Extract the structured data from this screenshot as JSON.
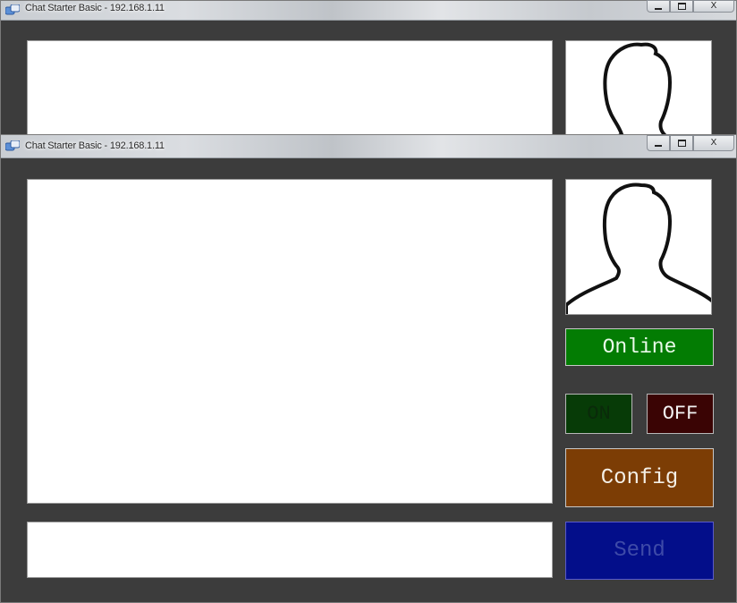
{
  "windows": {
    "back": {
      "title": "Chat Starter Basic - 192.168.1.11",
      "controls": {
        "minimize": "minimize",
        "maximize": "maximize",
        "close": "X"
      }
    },
    "front": {
      "title": "Chat Starter Basic - 192.168.1.11",
      "controls": {
        "minimize": "minimize",
        "maximize": "maximize",
        "close": "X"
      }
    }
  },
  "main": {
    "chat_log": "",
    "message_input": {
      "value": "",
      "placeholder": ""
    },
    "avatar": "user-silhouette-icon",
    "status_label": "Online",
    "on_label": "ON",
    "off_label": "OFF",
    "config_label": "Config",
    "send_label": "Send"
  },
  "colors": {
    "background": "#3c3c3c",
    "status_online": "#037c03",
    "on": "#073b07",
    "off": "#3a0404",
    "config": "#7c3d05",
    "send": "#030e8a"
  }
}
